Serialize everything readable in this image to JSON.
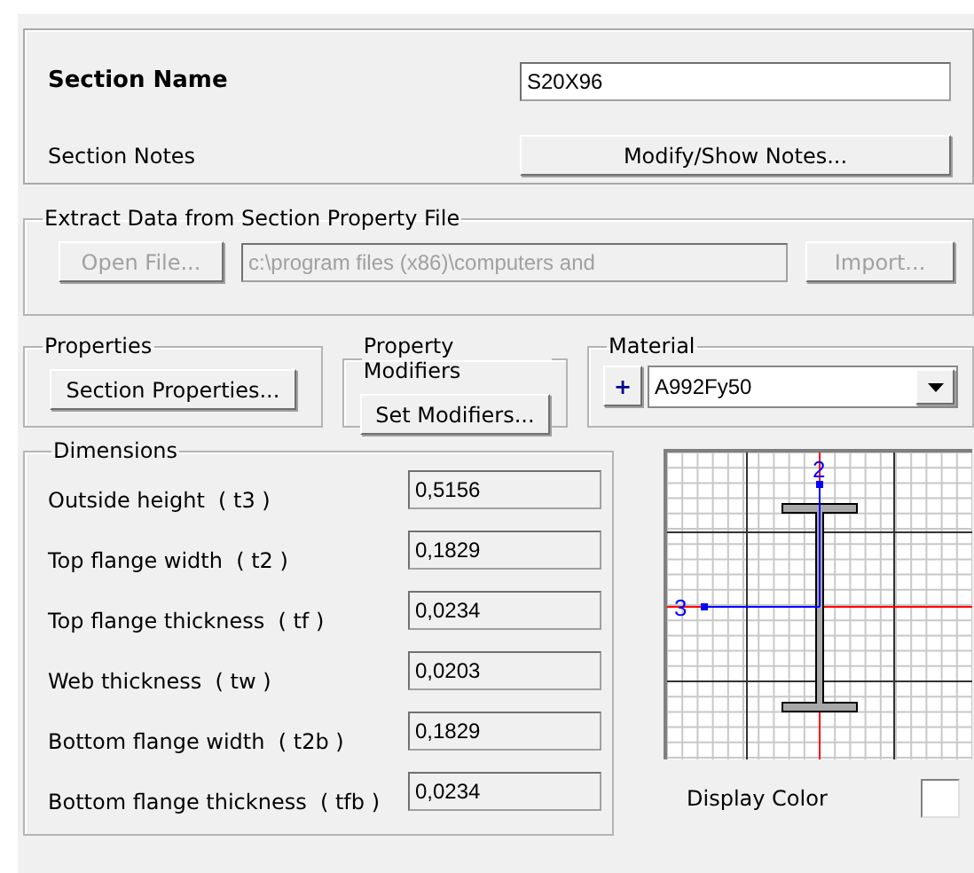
{
  "section": {
    "name_label": "Section Name",
    "name_value": "S20X96",
    "notes_label": "Section Notes",
    "notes_button": "Modify/Show Notes..."
  },
  "extract": {
    "title": "Extract Data from Section Property File",
    "open_button": {
      "label": "Open File...",
      "disabled": true
    },
    "path": {
      "value": "c:\\program files (x86)\\computers and",
      "disabled": true
    },
    "import_button": {
      "label": "Import...",
      "disabled": true
    }
  },
  "properties": {
    "title": "Properties",
    "button": "Section Properties..."
  },
  "modifiers": {
    "title": "Property Modifiers",
    "button": "Set Modifiers..."
  },
  "material": {
    "title": "Material",
    "add_button": "+",
    "value": "A992Fy50"
  },
  "dimensions": {
    "title": "Dimensions",
    "rows": [
      {
        "label": "Outside height  ( t3 )",
        "value": "0,5156"
      },
      {
        "label": "Top flange width  ( t2 )",
        "value": "0,1829"
      },
      {
        "label": "Top flange thickness  ( tf )",
        "value": "0,0234"
      },
      {
        "label": "Web thickness  ( tw )",
        "value": "0,0203"
      },
      {
        "label": "Bottom flange width  ( t2b )",
        "value": "0,1829"
      },
      {
        "label": "Bottom flange thickness  ( tfb )",
        "value": "0,0234"
      }
    ]
  },
  "preview": {
    "axis_2_label": "2",
    "axis_3_label": "3"
  },
  "display_color": {
    "label": "Display Color",
    "color": "#ffffff"
  }
}
